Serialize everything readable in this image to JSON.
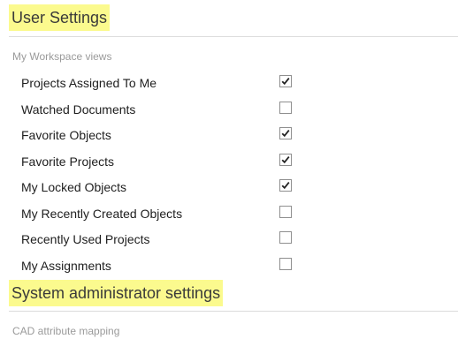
{
  "user_settings": {
    "title": "User Settings",
    "subheading": "My Workspace views",
    "items": [
      {
        "label": "Projects Assigned To Me",
        "checked": true
      },
      {
        "label": "Watched Documents",
        "checked": false
      },
      {
        "label": "Favorite Objects",
        "checked": true
      },
      {
        "label": "Favorite Projects",
        "checked": true
      },
      {
        "label": "My Locked Objects",
        "checked": true
      },
      {
        "label": "My Recently Created Objects",
        "checked": false
      },
      {
        "label": "Recently Used Projects",
        "checked": false
      },
      {
        "label": "My Assignments",
        "checked": false
      }
    ]
  },
  "admin_settings": {
    "title": "System administrator settings",
    "subheading": "CAD attribute mapping"
  },
  "colors": {
    "highlight": "#fbfa8e",
    "checkmark": "#222222"
  }
}
